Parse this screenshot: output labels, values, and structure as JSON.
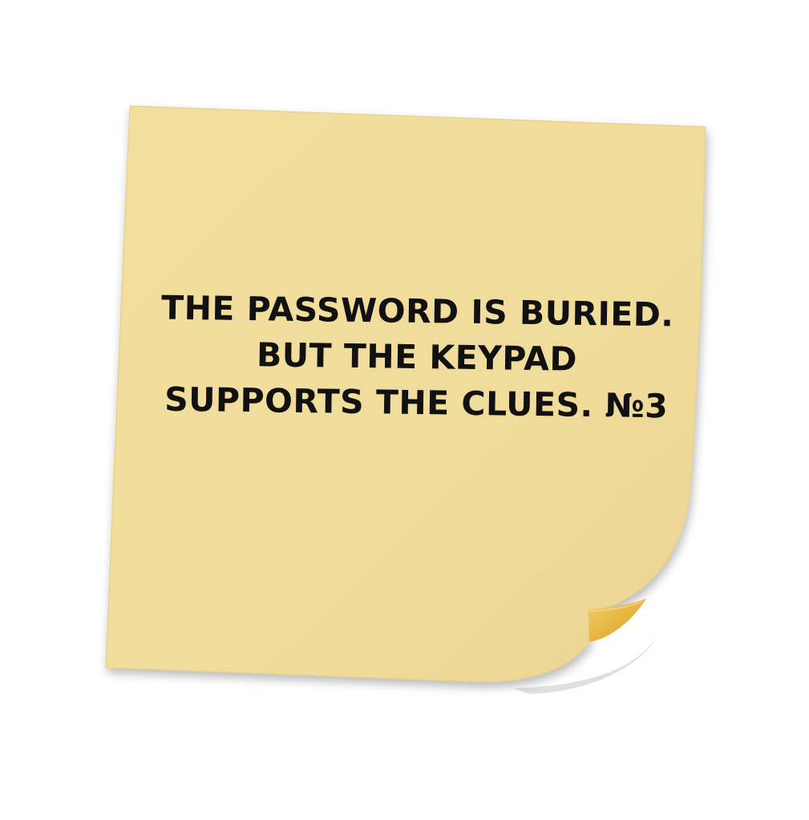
{
  "note": {
    "lines": [
      "THE PASSWORD IS BURIED.",
      "BUT THE KEYPAD",
      "SUPPORTS THE CLUES. №3"
    ],
    "paper_color": "#f0dc9b",
    "curl_color": "#e6b43f",
    "text_color": "#111111"
  }
}
